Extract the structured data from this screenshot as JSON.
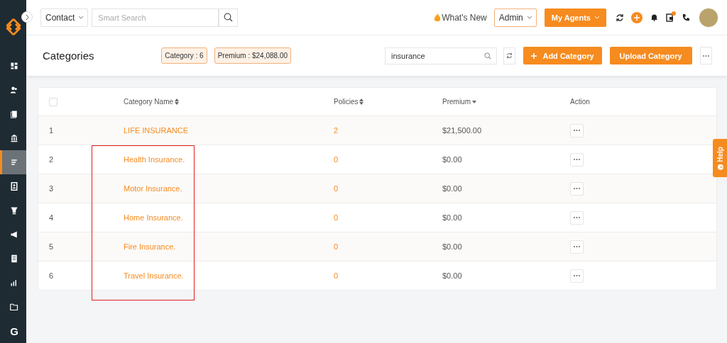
{
  "sidebar": {
    "items": [
      {
        "selected": false
      },
      {
        "selected": false
      },
      {
        "selected": false
      },
      {
        "selected": false
      },
      {
        "selected": true
      },
      {
        "selected": false
      },
      {
        "selected": false
      },
      {
        "selected": false
      },
      {
        "selected": false
      },
      {
        "selected": false
      },
      {
        "selected": false
      },
      {
        "selected": false,
        "label": "G"
      }
    ]
  },
  "topbar": {
    "module": "Contact",
    "search": {
      "placeholder": "Smart Search"
    },
    "whats_new": "What's New",
    "role": "Admin",
    "agents_button": "My Agents",
    "notification_dot": true
  },
  "header": {
    "title": "Categories",
    "badges": [
      "Category : 6",
      "Premium : $24,088.00"
    ],
    "search": {
      "value": "insurance"
    },
    "buttons": [
      {
        "label": "Add Category",
        "kind": "add"
      },
      {
        "label": "Upload Category",
        "kind": "plain"
      }
    ]
  },
  "table": {
    "select_all": {
      "checked": false
    },
    "columns": [
      {
        "label": "Category Name",
        "sortable": true,
        "sorted": false
      },
      {
        "label": "Policies",
        "sortable": true,
        "sorted": false
      },
      {
        "label": "Premium",
        "sortable": true,
        "sorted": true
      },
      {
        "label": "Action",
        "sortable": false,
        "sorted": false
      }
    ],
    "rows": [
      {
        "index": "1",
        "name": "LIFE INSURANCE",
        "policies": "2",
        "premium": "$21,500.00"
      },
      {
        "index": "2",
        "name": "Health Insurance.",
        "policies": "0",
        "premium": "$0.00"
      },
      {
        "index": "3",
        "name": "Motor Insurance.",
        "policies": "0",
        "premium": "$0.00"
      },
      {
        "index": "4",
        "name": "Home Insurance.",
        "policies": "0",
        "premium": "$0.00"
      },
      {
        "index": "5",
        "name": "Fire Insurance.",
        "policies": "0",
        "premium": "$0.00"
      },
      {
        "index": "6",
        "name": "Travel Insurance.",
        "policies": "0",
        "premium": "$0.00"
      }
    ]
  },
  "help_tab": "Help"
}
